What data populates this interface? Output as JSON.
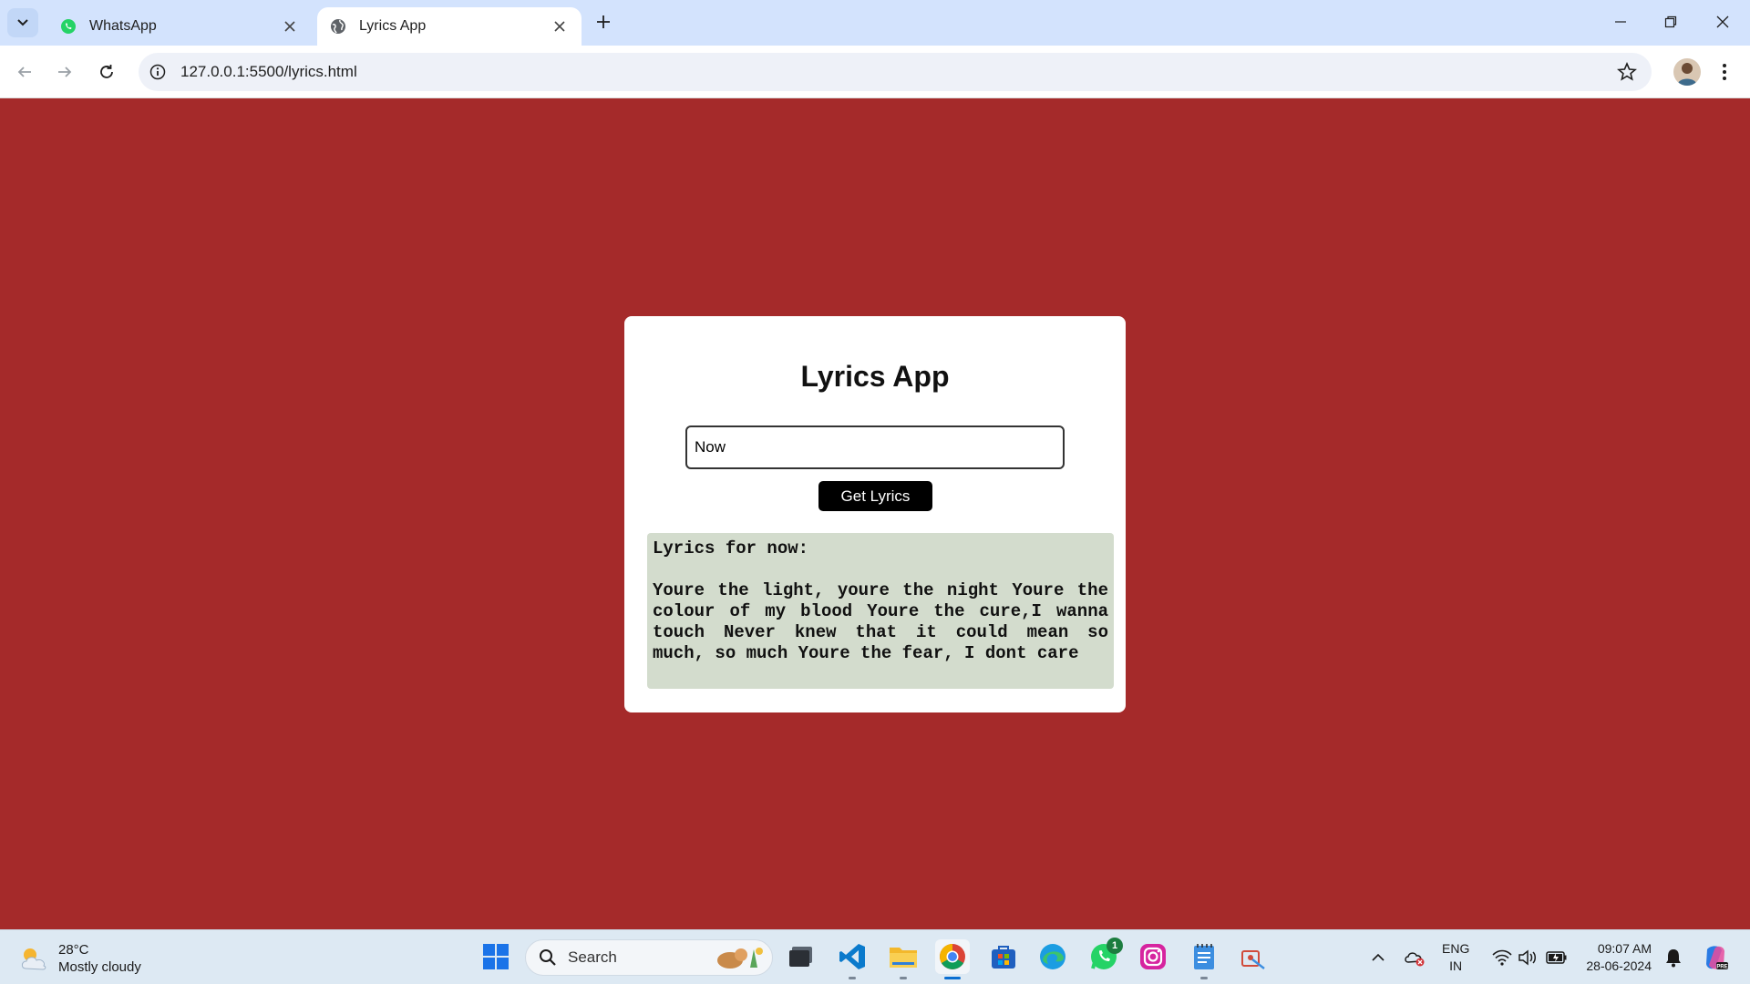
{
  "browser": {
    "tabs": [
      {
        "title": "WhatsApp",
        "favicon": "whatsapp-icon",
        "active": false
      },
      {
        "title": "Lyrics App",
        "favicon": "globe-icon",
        "active": true
      }
    ],
    "url": "127.0.0.1:5500/lyrics.html"
  },
  "page": {
    "title": "Lyrics App",
    "search_value": "Now",
    "button_label": "Get Lyrics",
    "lyrics_heading": "Lyrics for now:",
    "lyrics_text": "Youre the light, youre the night Youre the colour of my blood Youre the cure,I wanna touch Never knew that it could mean so much, so much Youre the fear, I dont care",
    "background_color": "#a52a2a",
    "lyrics_bg_color": "#d3dccd"
  },
  "taskbar": {
    "weather_temp": "28°C",
    "weather_desc": "Mostly cloudy",
    "search_label": "Search",
    "lang_line1": "ENG",
    "lang_line2": "IN",
    "time": "09:07 AM",
    "date": "28-06-2024",
    "whatsapp_badge": "1"
  }
}
